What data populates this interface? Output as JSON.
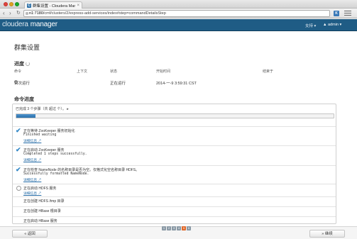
{
  "browser": {
    "tab_title": "群集设置 - Cloudera Mana",
    "tab_close": "×",
    "url_host": "n1:7180",
    "url_path": "/cmf/clusters/2/express-add-services/index#step=commandDetailsStep"
  },
  "app": {
    "logo_part1": "cloudera",
    "logo_part2": "manager",
    "help": "支持 ▾",
    "user": "▲ admin ▾"
  },
  "page": {
    "title": "群集设置",
    "progress_heading": "进度",
    "table": {
      "headers": [
        "命令",
        "上下文",
        "状态",
        "开始时间",
        "结束于"
      ],
      "row": [
        "首次运行",
        "",
        "正在运行",
        "2014-一-9 3:59:31 CST",
        ""
      ]
    },
    "command_heading": "命令进度",
    "summary": "已完成 3 个步骤（共 超过 个）。",
    "progress_fraction": 0.06
  },
  "steps": [
    {
      "status": "done",
      "title": "正在等待 ZooKeeper 服务初始化",
      "output": "Finished waiting",
      "link": "详细信息 ↗"
    },
    {
      "status": "done",
      "title": "正在启动 ZooKeeper 服务",
      "output": "Completed 1 steps successfully.",
      "link": "详细信息 ↗"
    },
    {
      "status": "done",
      "title": "正在检查 NameNode 的名称目录是否为空。仅格式化空名称目录 HDFS。",
      "output": "Successfully formatted NameNode.",
      "link": "详细信息 ↗"
    },
    {
      "status": "running",
      "title": "正在启动 HDFS 服务",
      "link": "详细信息 ↗"
    },
    {
      "status": "pending",
      "title": "正在创建 HDFS /tmp 目录"
    },
    {
      "status": "pending",
      "title": "正在创建 HBase 根目录"
    },
    {
      "status": "pending",
      "title": "正在启动 HBase 服务"
    }
  ],
  "footer": {
    "back": "« 返回",
    "next": "» 继续",
    "pages": [
      "1",
      "2",
      "3",
      "4",
      "5",
      "6"
    ],
    "active_page": "5"
  },
  "colors": {
    "header_bg": "#1f5c85",
    "check": "#3489c7",
    "progress": "#2a6fa9",
    "pager_active": "#e06a2c"
  }
}
